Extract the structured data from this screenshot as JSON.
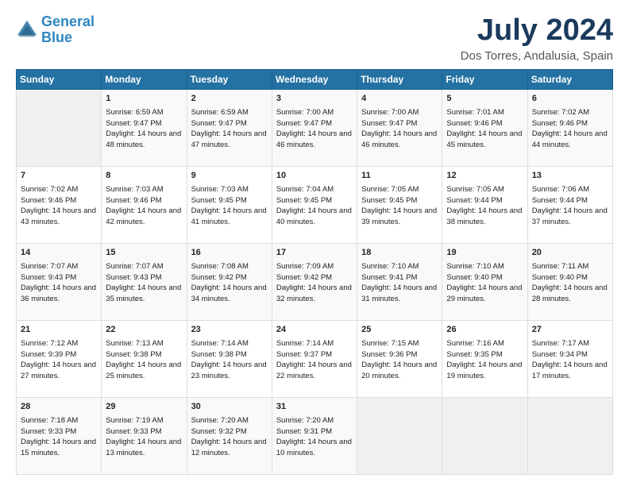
{
  "header": {
    "logo_line1": "General",
    "logo_line2": "Blue",
    "title": "July 2024",
    "subtitle": "Dos Torres, Andalusia, Spain"
  },
  "columns": [
    "Sunday",
    "Monday",
    "Tuesday",
    "Wednesday",
    "Thursday",
    "Friday",
    "Saturday"
  ],
  "weeks": [
    [
      {
        "day": "",
        "sunrise": "",
        "sunset": "",
        "daylight": ""
      },
      {
        "day": "1",
        "sunrise": "Sunrise: 6:59 AM",
        "sunset": "Sunset: 9:47 PM",
        "daylight": "Daylight: 14 hours and 48 minutes."
      },
      {
        "day": "2",
        "sunrise": "Sunrise: 6:59 AM",
        "sunset": "Sunset: 9:47 PM",
        "daylight": "Daylight: 14 hours and 47 minutes."
      },
      {
        "day": "3",
        "sunrise": "Sunrise: 7:00 AM",
        "sunset": "Sunset: 9:47 PM",
        "daylight": "Daylight: 14 hours and 46 minutes."
      },
      {
        "day": "4",
        "sunrise": "Sunrise: 7:00 AM",
        "sunset": "Sunset: 9:47 PM",
        "daylight": "Daylight: 14 hours and 46 minutes."
      },
      {
        "day": "5",
        "sunrise": "Sunrise: 7:01 AM",
        "sunset": "Sunset: 9:46 PM",
        "daylight": "Daylight: 14 hours and 45 minutes."
      },
      {
        "day": "6",
        "sunrise": "Sunrise: 7:02 AM",
        "sunset": "Sunset: 9:46 PM",
        "daylight": "Daylight: 14 hours and 44 minutes."
      }
    ],
    [
      {
        "day": "7",
        "sunrise": "Sunrise: 7:02 AM",
        "sunset": "Sunset: 9:46 PM",
        "daylight": "Daylight: 14 hours and 43 minutes."
      },
      {
        "day": "8",
        "sunrise": "Sunrise: 7:03 AM",
        "sunset": "Sunset: 9:46 PM",
        "daylight": "Daylight: 14 hours and 42 minutes."
      },
      {
        "day": "9",
        "sunrise": "Sunrise: 7:03 AM",
        "sunset": "Sunset: 9:45 PM",
        "daylight": "Daylight: 14 hours and 41 minutes."
      },
      {
        "day": "10",
        "sunrise": "Sunrise: 7:04 AM",
        "sunset": "Sunset: 9:45 PM",
        "daylight": "Daylight: 14 hours and 40 minutes."
      },
      {
        "day": "11",
        "sunrise": "Sunrise: 7:05 AM",
        "sunset": "Sunset: 9:45 PM",
        "daylight": "Daylight: 14 hours and 39 minutes."
      },
      {
        "day": "12",
        "sunrise": "Sunrise: 7:05 AM",
        "sunset": "Sunset: 9:44 PM",
        "daylight": "Daylight: 14 hours and 38 minutes."
      },
      {
        "day": "13",
        "sunrise": "Sunrise: 7:06 AM",
        "sunset": "Sunset: 9:44 PM",
        "daylight": "Daylight: 14 hours and 37 minutes."
      }
    ],
    [
      {
        "day": "14",
        "sunrise": "Sunrise: 7:07 AM",
        "sunset": "Sunset: 9:43 PM",
        "daylight": "Daylight: 14 hours and 36 minutes."
      },
      {
        "day": "15",
        "sunrise": "Sunrise: 7:07 AM",
        "sunset": "Sunset: 9:43 PM",
        "daylight": "Daylight: 14 hours and 35 minutes."
      },
      {
        "day": "16",
        "sunrise": "Sunrise: 7:08 AM",
        "sunset": "Sunset: 9:42 PM",
        "daylight": "Daylight: 14 hours and 34 minutes."
      },
      {
        "day": "17",
        "sunrise": "Sunrise: 7:09 AM",
        "sunset": "Sunset: 9:42 PM",
        "daylight": "Daylight: 14 hours and 32 minutes."
      },
      {
        "day": "18",
        "sunrise": "Sunrise: 7:10 AM",
        "sunset": "Sunset: 9:41 PM",
        "daylight": "Daylight: 14 hours and 31 minutes."
      },
      {
        "day": "19",
        "sunrise": "Sunrise: 7:10 AM",
        "sunset": "Sunset: 9:40 PM",
        "daylight": "Daylight: 14 hours and 29 minutes."
      },
      {
        "day": "20",
        "sunrise": "Sunrise: 7:11 AM",
        "sunset": "Sunset: 9:40 PM",
        "daylight": "Daylight: 14 hours and 28 minutes."
      }
    ],
    [
      {
        "day": "21",
        "sunrise": "Sunrise: 7:12 AM",
        "sunset": "Sunset: 9:39 PM",
        "daylight": "Daylight: 14 hours and 27 minutes."
      },
      {
        "day": "22",
        "sunrise": "Sunrise: 7:13 AM",
        "sunset": "Sunset: 9:38 PM",
        "daylight": "Daylight: 14 hours and 25 minutes."
      },
      {
        "day": "23",
        "sunrise": "Sunrise: 7:14 AM",
        "sunset": "Sunset: 9:38 PM",
        "daylight": "Daylight: 14 hours and 23 minutes."
      },
      {
        "day": "24",
        "sunrise": "Sunrise: 7:14 AM",
        "sunset": "Sunset: 9:37 PM",
        "daylight": "Daylight: 14 hours and 22 minutes."
      },
      {
        "day": "25",
        "sunrise": "Sunrise: 7:15 AM",
        "sunset": "Sunset: 9:36 PM",
        "daylight": "Daylight: 14 hours and 20 minutes."
      },
      {
        "day": "26",
        "sunrise": "Sunrise: 7:16 AM",
        "sunset": "Sunset: 9:35 PM",
        "daylight": "Daylight: 14 hours and 19 minutes."
      },
      {
        "day": "27",
        "sunrise": "Sunrise: 7:17 AM",
        "sunset": "Sunset: 9:34 PM",
        "daylight": "Daylight: 14 hours and 17 minutes."
      }
    ],
    [
      {
        "day": "28",
        "sunrise": "Sunrise: 7:18 AM",
        "sunset": "Sunset: 9:33 PM",
        "daylight": "Daylight: 14 hours and 15 minutes."
      },
      {
        "day": "29",
        "sunrise": "Sunrise: 7:19 AM",
        "sunset": "Sunset: 9:33 PM",
        "daylight": "Daylight: 14 hours and 13 minutes."
      },
      {
        "day": "30",
        "sunrise": "Sunrise: 7:20 AM",
        "sunset": "Sunset: 9:32 PM",
        "daylight": "Daylight: 14 hours and 12 minutes."
      },
      {
        "day": "31",
        "sunrise": "Sunrise: 7:20 AM",
        "sunset": "Sunset: 9:31 PM",
        "daylight": "Daylight: 14 hours and 10 minutes."
      },
      {
        "day": "",
        "sunrise": "",
        "sunset": "",
        "daylight": ""
      },
      {
        "day": "",
        "sunrise": "",
        "sunset": "",
        "daylight": ""
      },
      {
        "day": "",
        "sunrise": "",
        "sunset": "",
        "daylight": ""
      }
    ]
  ]
}
